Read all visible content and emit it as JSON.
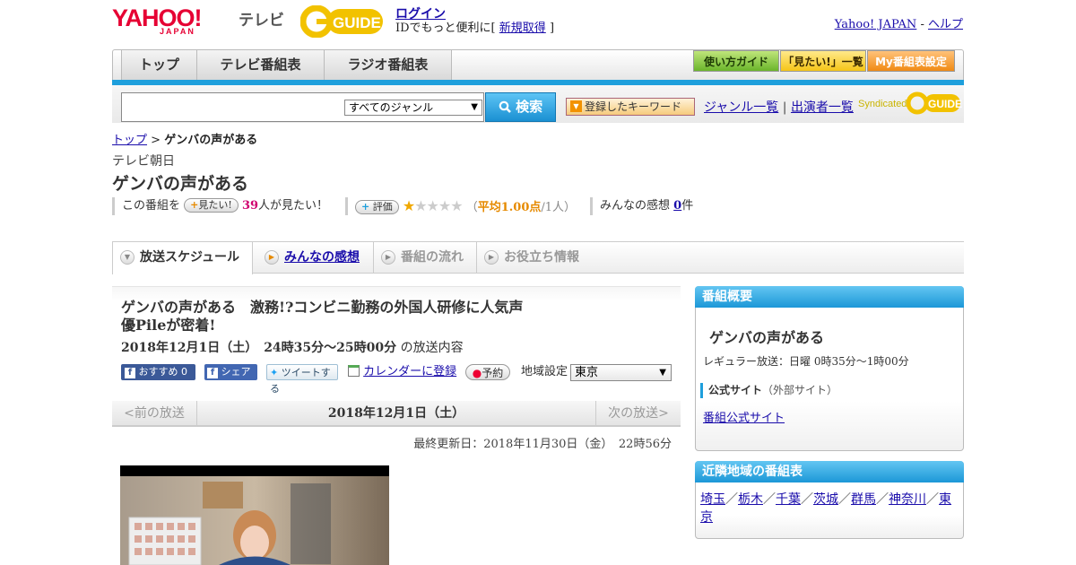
{
  "header": {
    "brand_yahoo": "YAHOO!",
    "brand_japan": "JAPAN",
    "brand_tv": "テレビ",
    "brand_guide": "GUIDE",
    "login": "ログイン",
    "login_sub_prefix": "IDでもっと便利に[",
    "signup": "新規取得",
    "login_sub_suffix": "]",
    "yahoo_japan_link": "Yahoo! JAPAN",
    "separator": " - ",
    "help_link": "ヘルプ"
  },
  "nav": {
    "tabs": [
      "トップ",
      "テレビ番組表",
      "ラジオ番組表"
    ],
    "right_buttons": [
      "使い方ガイド",
      "「見たい!」一覧",
      "My番組表設定"
    ]
  },
  "search": {
    "genre": "すべてのジャンル",
    "button": "検索",
    "keyword_button": "登録したキーワード",
    "genre_list": "ジャンル一覧",
    "divider": "|",
    "cast_list": "出演者一覧",
    "syndicated": "Syndicated"
  },
  "breadcrumb": {
    "top": "トップ",
    "sep": " > ",
    "current": "ゲンバの声がある"
  },
  "program": {
    "station": "テレビ朝日",
    "title": "ゲンバの声がある",
    "want_prefix": "この番組を",
    "want_button": "見たい!",
    "want_count": "39",
    "want_suffix": "人が見たい！",
    "rate_button": "評価",
    "rating_filled": 1,
    "rating_total": 5,
    "avg_open": "（",
    "avg_label": "平均1.00点",
    "avg_count": "/1人）",
    "impressions_prefix": "みんなの感想",
    "impressions_count": "0",
    "impressions_suffix": "件"
  },
  "subtabs": [
    "放送スケジュール",
    "みんなの感想",
    "番組の流れ",
    "お役立ち情報"
  ],
  "broadcast": {
    "title": "ゲンバの声がある　激務!?コンビニ勤務の外国人研修に人気声優Pileが密着!",
    "date_time": "2018年12月1日（土）　24時35分～25時00分",
    "date_suffix": "の放送内容",
    "share": {
      "recommend": "おすすめ",
      "recommend_count": "0",
      "fb_share": "シェア",
      "tweet": "ツイートする",
      "calendar": "カレンダーに登録",
      "reserve": "予約"
    },
    "region_label": "地域設定",
    "region_value": "東京",
    "prev": "<前の放送",
    "current_date": "2018年12月1日（土）",
    "next": "次の放送>",
    "updated": "最終更新日：2018年11月30日（金）　22時56分"
  },
  "overview": {
    "heading": "番組概要",
    "title": "ゲンバの声がある",
    "regular": "レギュラー放送：日曜 0時35分～1時00分",
    "official_label": "公式サイト",
    "official_note": "（外部サイト）",
    "official_link": "番組公式サイト"
  },
  "nearby": {
    "heading": "近隣地域の番組表",
    "regions": [
      "埼玉",
      "栃木",
      "千葉",
      "茨城",
      "群馬",
      "神奈川",
      "東京"
    ],
    "sep": "／"
  },
  "colors": {
    "accent_blue": "#1e9fdc",
    "yahoo_red": "#e60033",
    "want_count": "#d0006f",
    "rating_orange": "#e68a00"
  }
}
